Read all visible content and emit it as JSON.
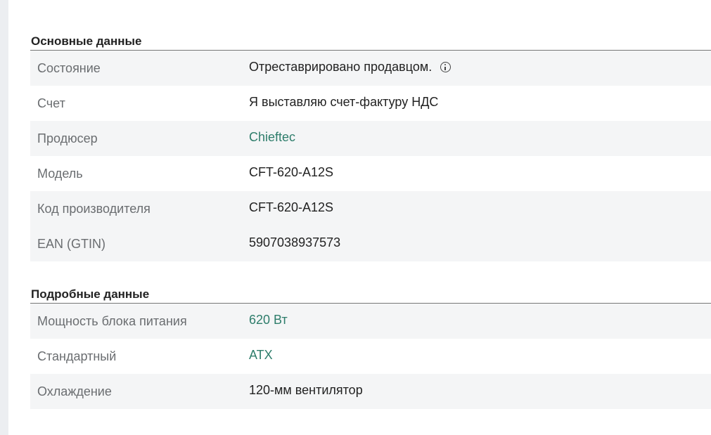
{
  "sections": [
    {
      "title": "Основные данные",
      "rows": [
        {
          "label": "Состояние",
          "value": "Отреставрировано продавцом.",
          "link": false,
          "info": true
        },
        {
          "label": "Счет",
          "value": "Я выставляю счет-фактуру НДС",
          "link": false,
          "info": false
        },
        {
          "label": "Продюсер",
          "value": "Chieftec",
          "link": true,
          "info": false
        },
        {
          "label": "Модель",
          "value": "CFT-620-A12S",
          "link": false,
          "info": false
        },
        {
          "label": "Код производителя",
          "value": "CFT-620-A12S",
          "link": false,
          "info": false
        },
        {
          "label": "EAN (GTIN)",
          "value": "5907038937573",
          "link": false,
          "info": false
        }
      ]
    },
    {
      "title": "Подробные данные",
      "rows": [
        {
          "label": "Мощность блока питания",
          "value": "620 Вт",
          "link": true,
          "info": false
        },
        {
          "label": "Стандартный",
          "value": "ATX",
          "link": true,
          "info": false
        },
        {
          "label": "Охлаждение",
          "value": "120-мм вентилятор",
          "link": false,
          "info": false
        }
      ]
    }
  ],
  "icons": {
    "info": "info-circle-icon"
  },
  "colors": {
    "link": "#2e7d6b",
    "label": "#6a6d70",
    "row_alt": "#f4f5f6"
  }
}
